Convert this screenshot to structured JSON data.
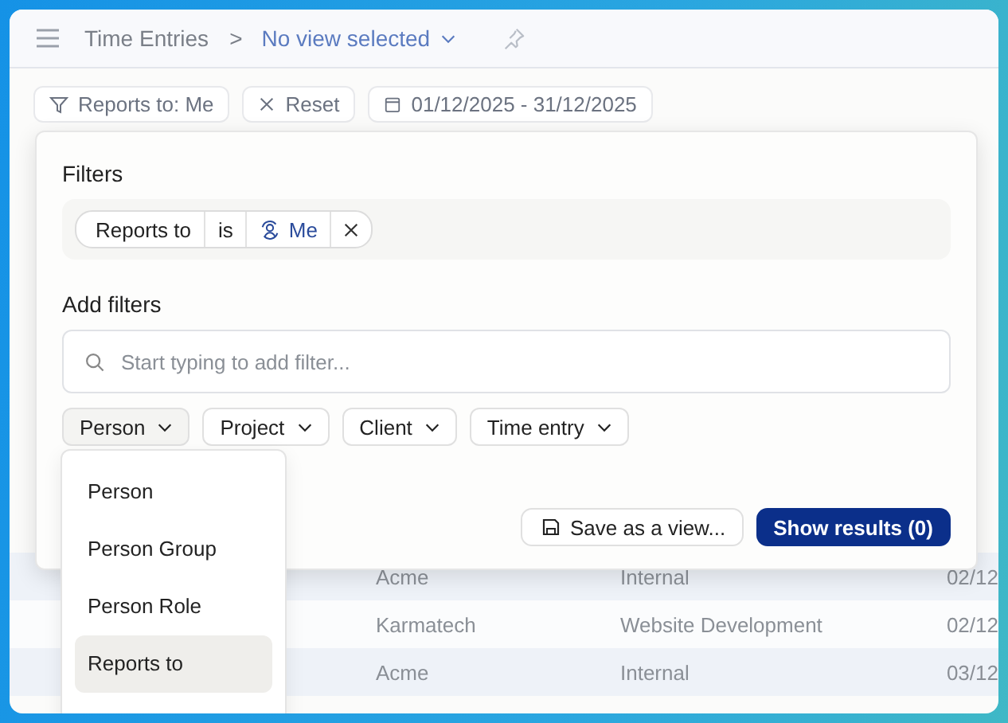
{
  "header": {
    "title": "Time Entries",
    "separator": ">",
    "view": "No view selected"
  },
  "toolbar": {
    "filter": "Reports to: Me",
    "reset": "Reset",
    "date_range": "01/12/2025 - 31/12/2025"
  },
  "table": {
    "rows": [
      {
        "client": "Acme",
        "project": "Internal",
        "date": "02/12"
      },
      {
        "client": "Karmatech",
        "project": "Website Development",
        "date": "02/12"
      },
      {
        "client": "Acme",
        "project": "Internal",
        "date": "03/12"
      }
    ]
  },
  "filter_panel": {
    "title": "Filters",
    "active_filter": {
      "field": "Reports to",
      "operator": "is",
      "value": "Me"
    },
    "add_title": "Add filters",
    "search": {
      "placeholder": "Start typing to add filter..."
    },
    "categories": [
      {
        "label": "Person",
        "expanded": true
      },
      {
        "label": "Project",
        "expanded": false
      },
      {
        "label": "Client",
        "expanded": false
      },
      {
        "label": "Time entry",
        "expanded": false
      }
    ],
    "save": "Save as a view...",
    "show": "Show results (0)"
  },
  "dropdown": {
    "items": [
      {
        "label": "Person",
        "selected": false
      },
      {
        "label": "Person Group",
        "selected": false
      },
      {
        "label": "Person Role",
        "selected": false
      },
      {
        "label": "Reports to",
        "selected": true
      }
    ]
  }
}
